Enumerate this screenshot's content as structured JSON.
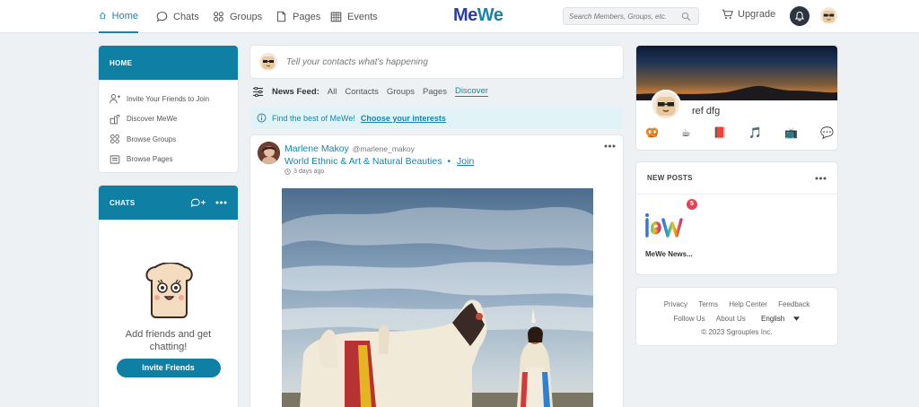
{
  "nav": {
    "home": "Home",
    "chats": "Chats",
    "groups": "Groups",
    "pages": "Pages",
    "events": "Events",
    "logo_me": "Me",
    "logo_we": "We",
    "search_placeholder": "Search Members, Groups, etc.",
    "upgrade": "Upgrade"
  },
  "left_home": {
    "title": "HOME",
    "items": [
      {
        "label": "Invite Your Friends to Join",
        "icon": "add-person-icon"
      },
      {
        "label": "Discover MeWe",
        "icon": "discover-icon"
      },
      {
        "label": "Browse Groups",
        "icon": "groups-icon"
      },
      {
        "label": "Browse Pages",
        "icon": "pages-icon"
      }
    ]
  },
  "left_chats": {
    "title": "CHATS",
    "message": "Add friends and get chatting!",
    "invite_button": "Invite Friends"
  },
  "composer": {
    "placeholder": "Tell your contacts what's happening"
  },
  "feed": {
    "label": "News Feed:",
    "filters": [
      "All",
      "Contacts",
      "Groups",
      "Pages",
      "Discover"
    ],
    "selected": "Discover",
    "discover_text": "Find the best of MeWe!",
    "discover_link": "Choose your interests"
  },
  "post": {
    "author": "Marlene Makoy",
    "handle": "@marlene_makoy",
    "group": "World Ethnic & Art & Natural Beauties",
    "separator": "•",
    "join": "Join",
    "time": "3 days ago"
  },
  "profile": {
    "name": "ref dfg",
    "emojis": [
      "🥨",
      "☕",
      "📕",
      "🎵",
      "📺",
      "💬"
    ]
  },
  "new_posts": {
    "title": "NEW POSTS",
    "badge": "5",
    "tile_label": "MeWe News..."
  },
  "footer": {
    "row1": [
      "Privacy",
      "Terms",
      "Help Center",
      "Feedback"
    ],
    "row2": [
      "Follow Us",
      "About Us"
    ],
    "language": "English",
    "copyright": "© 2023 Sgrouples Inc."
  },
  "colors": {
    "accent": "#1a84a6",
    "header_blue": "#0f7fa3",
    "badge_red": "#e84156"
  }
}
